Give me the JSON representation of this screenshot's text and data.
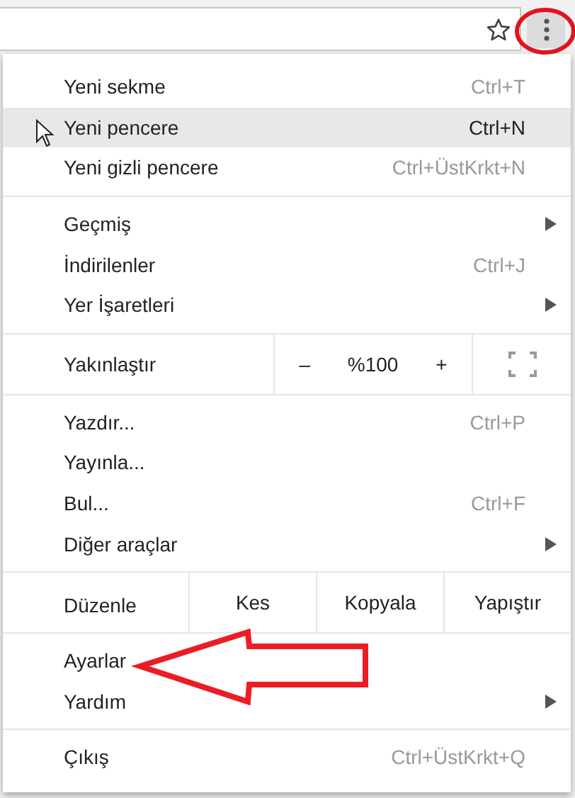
{
  "sections": [
    {
      "kind": "list",
      "items": [
        {
          "label": "Yeni sekme",
          "shortcut": "Ctrl+T",
          "submenu": false,
          "selected": false
        },
        {
          "label": "Yeni pencere",
          "shortcut": "Ctrl+N",
          "submenu": false,
          "selected": true
        },
        {
          "label": "Yeni gizli pencere",
          "shortcut": "Ctrl+ÜstKrkt+N",
          "submenu": false,
          "selected": false
        }
      ]
    },
    {
      "kind": "list",
      "items": [
        {
          "label": "Geçmiş",
          "submenu": true,
          "selected": false
        },
        {
          "label": "İndirilenler",
          "shortcut": "Ctrl+J",
          "submenu": false,
          "selected": false
        },
        {
          "label": "Yer İşaretleri",
          "submenu": true,
          "selected": false
        }
      ]
    },
    {
      "kind": "zoom",
      "label": "Yakınlaştır",
      "minus": "–",
      "value": "%100",
      "plus": "+"
    },
    {
      "kind": "list",
      "items": [
        {
          "label": "Yazdır...",
          "shortcut": "Ctrl+P",
          "submenu": false,
          "selected": false
        },
        {
          "label": "Yayınla...",
          "submenu": false,
          "selected": false
        },
        {
          "label": "Bul...",
          "shortcut": "Ctrl+F",
          "submenu": false,
          "selected": false
        },
        {
          "label": "Diğer araçlar",
          "submenu": true,
          "selected": false
        }
      ]
    },
    {
      "kind": "edit",
      "label": "Düzenle",
      "buttons": [
        "Kes",
        "Kopyala",
        "Yapıştır"
      ]
    },
    {
      "kind": "list",
      "items": [
        {
          "label": "Ayarlar",
          "submenu": false,
          "selected": false
        },
        {
          "label": "Yardım",
          "submenu": true,
          "selected": false
        }
      ]
    },
    {
      "kind": "list",
      "items": [
        {
          "label": "Çıkış",
          "shortcut": "Ctrl+ÜstKrkt+Q",
          "submenu": false,
          "selected": false
        }
      ]
    }
  ]
}
